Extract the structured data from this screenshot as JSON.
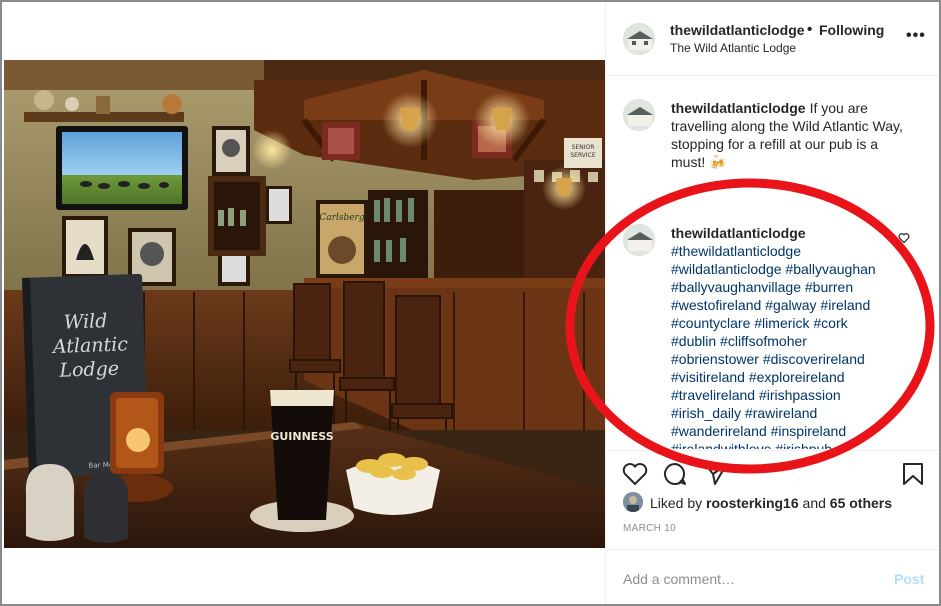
{
  "post": {
    "username": "thewildatlanticlodge",
    "follow_separator": "•",
    "follow_status": "Following",
    "location": "The Wild Atlantic Lodge",
    "more_icon": "more-options-icon",
    "more_label": "•••"
  },
  "photo": {
    "menu_text_line1": "Wild",
    "menu_text_line2": "Atlantic",
    "menu_text_line3": "Lodge",
    "menu_small_text": "Bar Menu",
    "glass_text": "GUINNESS",
    "poster_text": "Carlsberg",
    "sign_text_line1": "SENIOR",
    "sign_text_line2": "SERVICE"
  },
  "comments": [
    {
      "username": "thewildatlanticlodge",
      "text": "If you are travelling along the Wild Atlantic Way, stopping for a refill at our pub is a must! 🍻"
    },
    {
      "username": "thewildatlanticlodge",
      "hashtags": [
        "#thewildatlanticlodge",
        "#wildatlanticlodge #ballyvaughan",
        "#ballyvaughanvillage #burren",
        "#westofireland #galway #ireland",
        "#countyclare #limerick #cork",
        "#dublin #cliffsofmoher",
        "#obrienstower #discoverireland",
        "#visitireland #exploreireland",
        "#travelireland #irishpassion",
        "#irish_daily #rawireland",
        "#wanderireland #inspireland",
        "#irelandwithlove #irishpub"
      ]
    }
  ],
  "actions": {
    "like_icon": "heart-icon",
    "comment_icon": "comment-icon",
    "share_icon": "share-icon",
    "save_icon": "bookmark-icon"
  },
  "likes": {
    "prefix": "Liked by",
    "user": "roosterking16",
    "and": "and",
    "others": "65 others"
  },
  "date": "MARCH 10",
  "add_comment": {
    "placeholder": "Add a comment…",
    "post_label": "Post"
  },
  "colors": {
    "annotation": "#e8141a",
    "hashtag": "#003569",
    "post_disabled": "#b2dffc"
  }
}
